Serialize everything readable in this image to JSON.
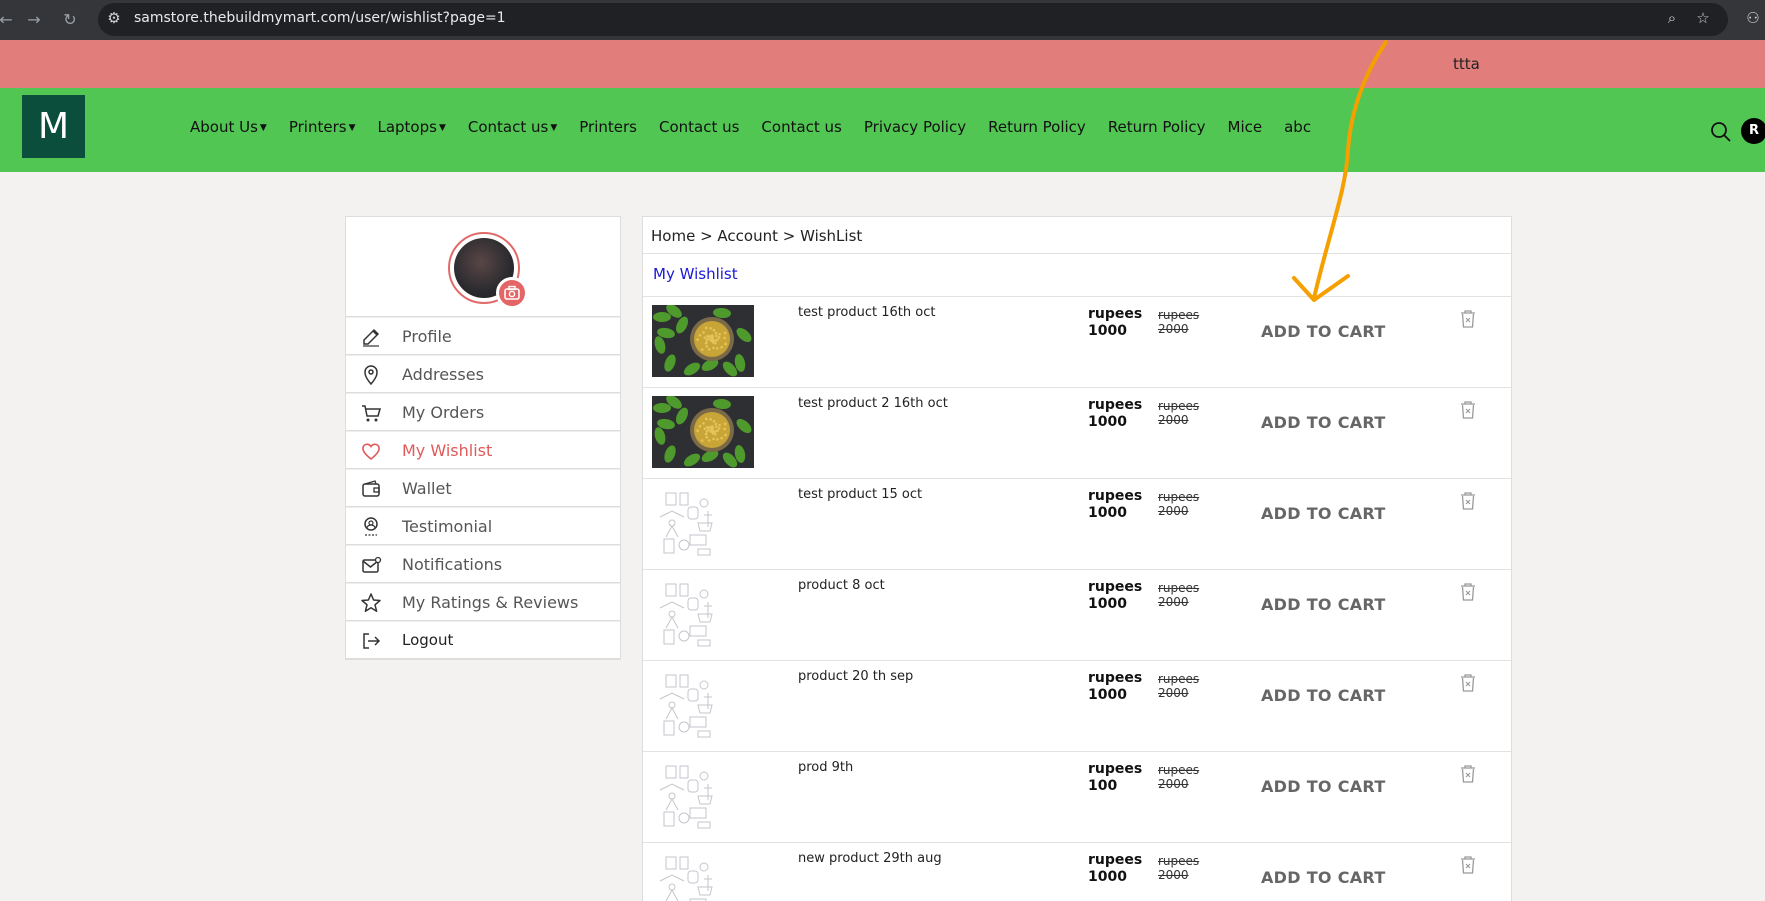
{
  "browser": {
    "url": "samstore.thebuildmymart.com/user/wishlist?page=1"
  },
  "announcement": {
    "text": "ttta"
  },
  "header": {
    "logo_letter": "M",
    "menu": [
      {
        "label": "About Us",
        "dropdown": true
      },
      {
        "label": "Printers",
        "dropdown": true
      },
      {
        "label": "Laptops",
        "dropdown": true
      },
      {
        "label": "Contact us",
        "dropdown": true
      },
      {
        "label": "Printers",
        "dropdown": false
      },
      {
        "label": "Contact us",
        "dropdown": false
      },
      {
        "label": "Contact us",
        "dropdown": false
      },
      {
        "label": "Privacy Policy",
        "dropdown": false
      },
      {
        "label": "Return Policy",
        "dropdown": false
      },
      {
        "label": "Return Policy",
        "dropdown": false
      },
      {
        "label": "Mice",
        "dropdown": false
      },
      {
        "label": "abc",
        "dropdown": false
      }
    ],
    "user_initial": "R"
  },
  "sidebar": {
    "items": [
      {
        "label": "Profile",
        "icon": "edit-icon"
      },
      {
        "label": "Addresses",
        "icon": "location-pin-icon"
      },
      {
        "label": "My Orders",
        "icon": "cart-icon"
      },
      {
        "label": "My Wishlist",
        "icon": "heart-icon",
        "active": true
      },
      {
        "label": "Wallet",
        "icon": "wallet-icon"
      },
      {
        "label": "Testimonial",
        "icon": "award-icon"
      },
      {
        "label": "Notifications",
        "icon": "mail-icon"
      },
      {
        "label": "My Ratings & Reviews",
        "icon": "star-icon"
      },
      {
        "label": "Logout",
        "icon": "logout-icon"
      }
    ]
  },
  "breadcrumb": "Home > Account > WishList",
  "wishlist": {
    "title": "My Wishlist",
    "add_to_cart_label": "ADD TO CART",
    "currency_label": "rupees",
    "items": [
      {
        "name": "test product 16th oct",
        "price": "1000",
        "old_price": "2000",
        "image": "food"
      },
      {
        "name": "test product 2 16th oct",
        "price": "1000",
        "old_price": "2000",
        "image": "food"
      },
      {
        "name": "test product 15 oct",
        "price": "1000",
        "old_price": "2000",
        "image": "placeholder"
      },
      {
        "name": "product 8 oct",
        "price": "1000",
        "old_price": "2000",
        "image": "placeholder"
      },
      {
        "name": "product 20 th sep",
        "price": "1000",
        "old_price": "2000",
        "image": "placeholder"
      },
      {
        "name": "prod 9th",
        "price": "100",
        "old_price": "2000",
        "image": "placeholder"
      },
      {
        "name": "new product 29th aug",
        "price": "1000",
        "old_price": "2000",
        "image": "placeholder"
      }
    ]
  },
  "colors": {
    "announce_bg": "#e17d7a",
    "header_bg": "#52c653",
    "logo_bg": "#0b4e3c",
    "active_red": "#e05a5a",
    "title_blue": "#1a1ad6",
    "annotation_orange": "#f5a000"
  }
}
